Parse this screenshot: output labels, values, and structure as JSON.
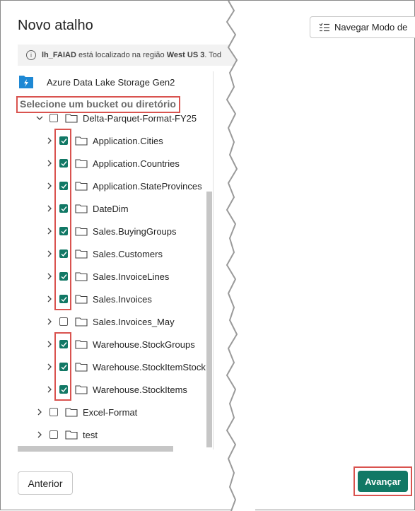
{
  "dialog": {
    "title": "Novo atalho",
    "navigate_mode_label": "Navegar Modo de"
  },
  "info": {
    "name": "lh_FAIAD",
    "text_mid": "está localizado na região",
    "region": "West US 3",
    "text_end": ". Tod"
  },
  "source": {
    "name": "Azure Data Lake Storage Gen2"
  },
  "section": {
    "label": "Selecione um bucket ou diretório"
  },
  "tree": {
    "root": {
      "label": "Delta-Parquet-Format-FY25",
      "checked": false
    },
    "items": [
      {
        "label": "Application.Cities",
        "checked": true
      },
      {
        "label": "Application.Countries",
        "checked": true
      },
      {
        "label": "Application.StateProvinces",
        "checked": true
      },
      {
        "label": "DateDim",
        "checked": true
      },
      {
        "label": "Sales.BuyingGroups",
        "checked": true
      },
      {
        "label": "Sales.Customers",
        "checked": true
      },
      {
        "label": "Sales.InvoiceLines",
        "checked": true
      },
      {
        "label": "Sales.Invoices",
        "checked": true
      },
      {
        "label": "Sales.Invoices_May",
        "checked": false
      },
      {
        "label": "Warehouse.StockGroups",
        "checked": true
      },
      {
        "label": "Warehouse.StockItemStock",
        "checked": true
      },
      {
        "label": "Warehouse.StockItems",
        "checked": true
      }
    ],
    "siblings": [
      {
        "label": "Excel-Format",
        "checked": false
      },
      {
        "label": "test",
        "checked": false
      }
    ]
  },
  "footer": {
    "prev_label": "Anterior",
    "next_label": "Avançar"
  },
  "colors": {
    "accent": "#117865",
    "highlight": "#d9534f"
  }
}
